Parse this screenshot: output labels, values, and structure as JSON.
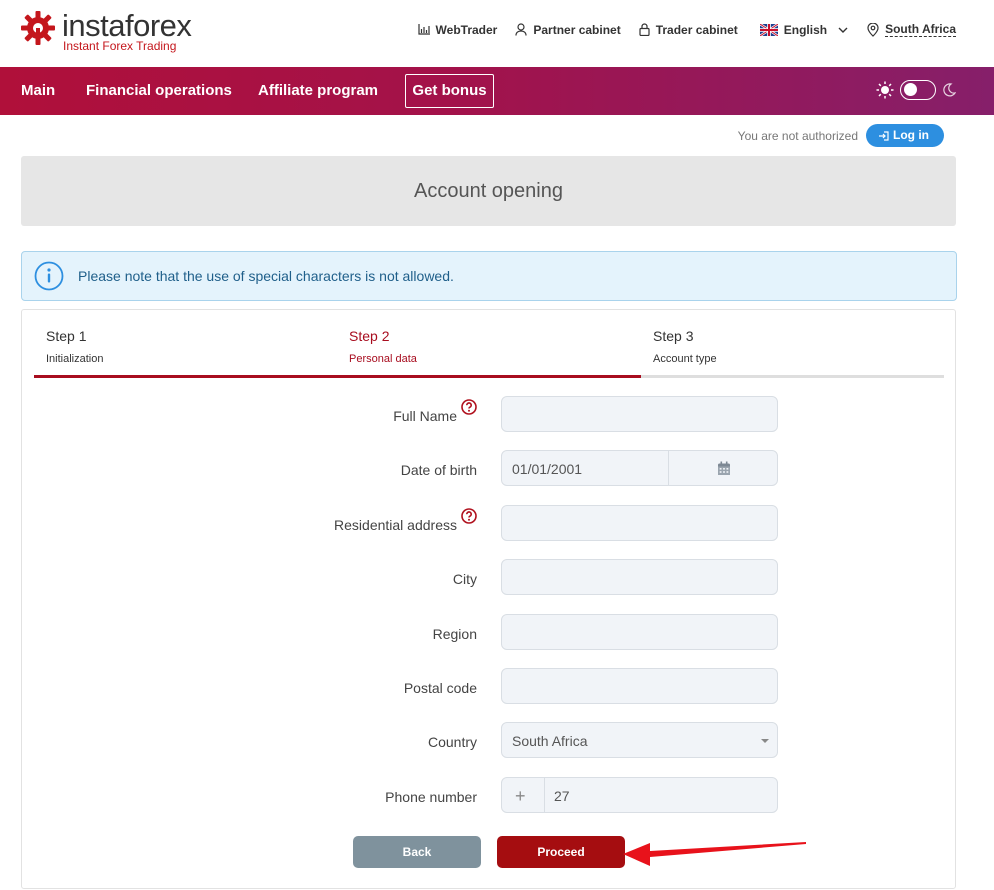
{
  "brand": {
    "name": "instaforex",
    "tagline": "Instant Forex Trading"
  },
  "top_links": {
    "webtrader": "WebTrader",
    "partner": "Partner cabinet",
    "trader": "Trader cabinet",
    "language": "English",
    "region": "South Africa"
  },
  "nav": {
    "main": "Main",
    "financial": "Financial operations",
    "affiliate": "Affiliate program",
    "bonus": "Get bonus"
  },
  "auth": {
    "status": "You are not authorized",
    "login": "Log in"
  },
  "page": {
    "title": "Account opening",
    "notice": "Please note that the use of special characters is not allowed."
  },
  "steps": [
    {
      "number": "Step 1",
      "label": "Initialization"
    },
    {
      "number": "Step 2",
      "label": "Personal data"
    },
    {
      "number": "Step 3",
      "label": "Account type"
    }
  ],
  "progress": {
    "completed_fraction": 0.667
  },
  "form": {
    "full_name": {
      "label": "Full Name",
      "value": ""
    },
    "dob": {
      "label": "Date of birth",
      "value": "01/01/2001"
    },
    "address": {
      "label": "Residential address",
      "value": ""
    },
    "city": {
      "label": "City",
      "value": ""
    },
    "region": {
      "label": "Region",
      "value": ""
    },
    "postal": {
      "label": "Postal code",
      "value": ""
    },
    "country": {
      "label": "Country",
      "value": "South Africa"
    },
    "phone": {
      "label": "Phone number",
      "prefix": "+",
      "value": "27"
    }
  },
  "buttons": {
    "back": "Back",
    "proceed": "Proceed"
  },
  "colors": {
    "brand_red": "#a80d1f",
    "nav_gradient_start": "#b0103a",
    "nav_gradient_end": "#861f6a",
    "login_blue": "#2d8fe0",
    "back_gray": "#7f929d",
    "proceed_red": "#a50d10",
    "annotation_arrow": "#e8121b"
  },
  "icons": [
    "gear-logo-icon",
    "chart-icon",
    "user-icon",
    "lock-icon",
    "uk-flag-icon",
    "chevron-down-icon",
    "location-pin-icon",
    "sun-icon",
    "moon-icon",
    "login-icon",
    "info-icon",
    "help-icon",
    "calendar-icon",
    "dropdown-caret-icon",
    "annotation-arrow"
  ]
}
